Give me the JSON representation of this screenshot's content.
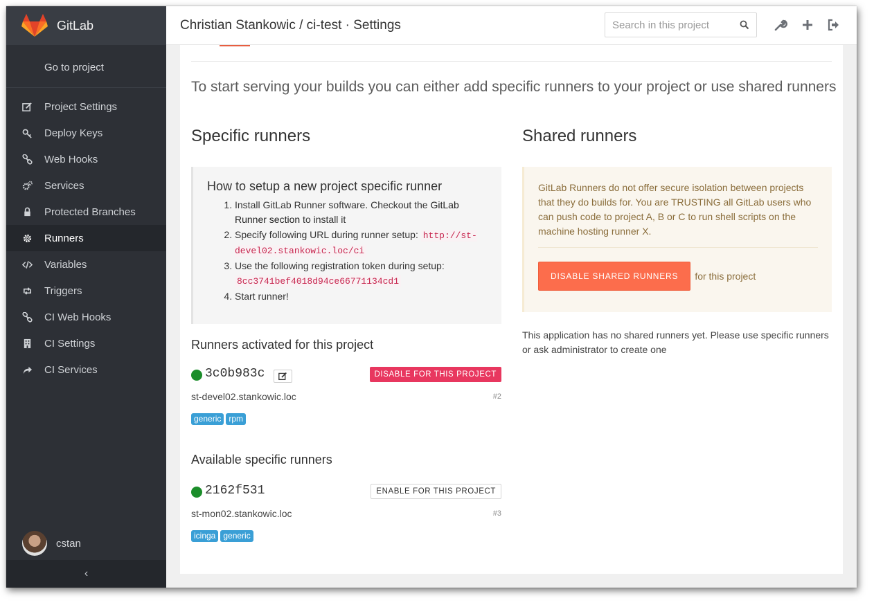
{
  "sidebar": {
    "brand": "GitLab",
    "go_to_project": "Go to project",
    "items": [
      {
        "label": "Project Settings",
        "icon": "edit-icon"
      },
      {
        "label": "Deploy Keys",
        "icon": "key-icon"
      },
      {
        "label": "Web Hooks",
        "icon": "link-icon"
      },
      {
        "label": "Services",
        "icon": "cogs-icon"
      },
      {
        "label": "Protected Branches",
        "icon": "lock-icon"
      },
      {
        "label": "Runners",
        "icon": "cog-icon"
      },
      {
        "label": "Variables",
        "icon": "code-icon"
      },
      {
        "label": "Triggers",
        "icon": "retweet-icon"
      },
      {
        "label": "CI Web Hooks",
        "icon": "link-icon"
      },
      {
        "label": "CI Settings",
        "icon": "building-icon"
      },
      {
        "label": "CI Services",
        "icon": "share-icon"
      }
    ],
    "active_item": "Runners",
    "user": "cstan",
    "collapse": "‹"
  },
  "header": {
    "title": "Christian Stankowic / ci-test · Settings",
    "search_placeholder": "Search in this project"
  },
  "main": {
    "intro": "To start serving your builds you can either add specific runners to your project or use shared runners",
    "specific": {
      "title": "Specific runners",
      "howto_title": "How to setup a new project specific runner",
      "step1_prefix": "Install GitLab Runner software. Checkout the ",
      "step1_link": "GitLab Runner section",
      "step1_suffix": " to install it",
      "step2_prefix": "Specify following URL during runner setup: ",
      "step2_url": "http://st-devel02.stankowic.loc/ci",
      "step3_prefix": "Use the following registration token during setup: ",
      "step3_token": "8cc3741bef4018d94ce66771134cd1",
      "step4": "Start runner!"
    },
    "activated": {
      "title": "Runners activated for this project",
      "runner": {
        "token": "3c0b983c",
        "host": "st-devel02.stankowic.loc",
        "id": "#2",
        "tags": [
          "generic",
          "rpm"
        ],
        "button": "DISABLE FOR THIS PROJECT"
      }
    },
    "available": {
      "title": "Available specific runners",
      "runner": {
        "token": "2162f531",
        "host": "st-mon02.stankowic.loc",
        "id": "#3",
        "tags": [
          "icinga",
          "generic"
        ],
        "button": "ENABLE FOR THIS PROJECT"
      }
    },
    "shared": {
      "title": "Shared runners",
      "warning": "GitLab Runners do not offer secure isolation between projects that they do builds for. You are TRUSTING all GitLab users who can push code to project A, B or C to run shell scripts on the machine hosting runner X.",
      "button": "DISABLE SHARED RUNNERS",
      "for_project": "for this project",
      "no_shared": "This application has no shared runners yet. Please use specific runners or ask administrator to create one"
    }
  },
  "colors": {
    "sidebar_bg": "#2d3036",
    "runner_online": "#1b8d2a",
    "danger": "#e8375f",
    "orange": "#fc6d4c",
    "tag": "#3a9fd6"
  }
}
